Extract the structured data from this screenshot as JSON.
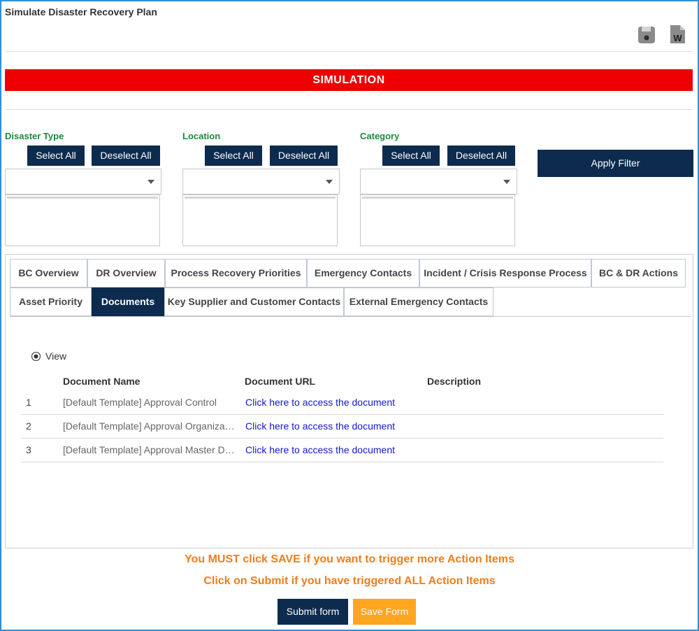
{
  "header": {
    "title": "Simulate Disaster Recovery Plan",
    "icons": [
      "save-icon",
      "word-export-icon"
    ],
    "word_icon_letter": "W"
  },
  "banner": {
    "label": "SIMULATION",
    "color": "#ee0000"
  },
  "filters": [
    {
      "label": "Disaster Type",
      "select_all": "Select All",
      "deselect_all": "Deselect All"
    },
    {
      "label": "Location",
      "select_all": "Select All",
      "deselect_all": "Deselect All"
    },
    {
      "label": "Category",
      "select_all": "Select All",
      "deselect_all": "Deselect All"
    }
  ],
  "apply_filter": "Apply Filter",
  "tabs": {
    "row1": [
      "BC Overview",
      "DR Overview",
      "Process Recovery Priorities",
      "Emergency Contacts",
      "Incident / Crisis Response Process",
      "BC & DR Actions"
    ],
    "row2": [
      "Asset Priority",
      "Documents",
      "Key Supplier and Customer Contacts",
      "External Emergency Contacts"
    ],
    "active": "Documents"
  },
  "documents": {
    "view_label": "View",
    "columns": [
      "Document Name",
      "Document URL",
      "Description"
    ],
    "rows": [
      {
        "num": "1",
        "name": "[Default Template] Approval Control",
        "url": "Click here to access the document",
        "description": ""
      },
      {
        "num": "2",
        "name": "[Default Template] Approval Organizati...",
        "url": "Click here to access the document",
        "description": ""
      },
      {
        "num": "3",
        "name": "[Default Template] Approval Master Da...",
        "url": "Click here to access the document",
        "description": ""
      }
    ]
  },
  "notices": {
    "save": "You MUST click SAVE if you want to trigger more Action Items",
    "submit": "Click on Submit if you have triggered ALL Action Items"
  },
  "actions": {
    "submit": "Submit form",
    "save": "Save Form"
  },
  "colors": {
    "navy": "#0d2b4e",
    "green_label": "#1a8a3a",
    "orange_notice": "#ef7d1a",
    "save_button": "#ffa51f",
    "link": "#1515d0"
  }
}
